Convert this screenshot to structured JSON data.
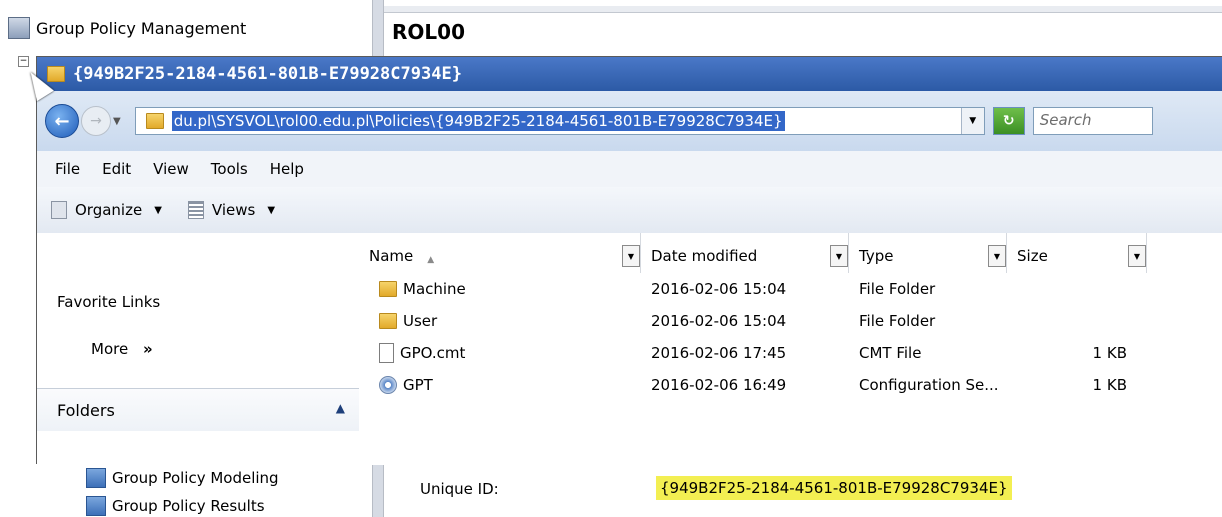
{
  "background": {
    "app_title": "Group Policy Management",
    "right_title": "ROL00",
    "tree": {
      "modeling": "Group Policy Modeling",
      "results": "Group Policy Results"
    },
    "unique_id_label": "Unique ID:",
    "unique_id_value": "{949B2F25-2184-4561-801B-E79928C7934E}"
  },
  "explorer": {
    "title": "{949B2F25-2184-4561-801B-E79928C7934E}",
    "address_path": "du.pl\\SYSVOL\\rol00.edu.pl\\Policies\\{949B2F25-2184-4561-801B-E79928C7934E}",
    "search_placeholder": "Search",
    "menu": [
      "File",
      "Edit",
      "View",
      "Tools",
      "Help"
    ],
    "toolbar": {
      "organize": "Organize",
      "views": "Views"
    },
    "favorites": {
      "title": "Favorite Links",
      "more": "More",
      "more_glyph": "»"
    },
    "folders_label": "Folders",
    "columns": {
      "name": "Name",
      "date": "Date modified",
      "type": "Type",
      "size": "Size"
    },
    "files": [
      {
        "name": "Machine",
        "date": "2016-02-06 15:04",
        "type": "File Folder",
        "size": "",
        "icon": "folder-icon"
      },
      {
        "name": "User",
        "date": "2016-02-06 15:04",
        "type": "File Folder",
        "size": "",
        "icon": "folder-icon"
      },
      {
        "name": "GPO.cmt",
        "date": "2016-02-06 17:45",
        "type": "CMT File",
        "size": "1 KB",
        "icon": "file-icon"
      },
      {
        "name": "GPT",
        "date": "2016-02-06 16:49",
        "type": "Configuration Se...",
        "size": "1 KB",
        "icon": "config-file-icon"
      }
    ]
  },
  "colors": {
    "titlebar": "#2c5aa6",
    "highlight": "#f3ef52",
    "selection": "#3367c8"
  }
}
